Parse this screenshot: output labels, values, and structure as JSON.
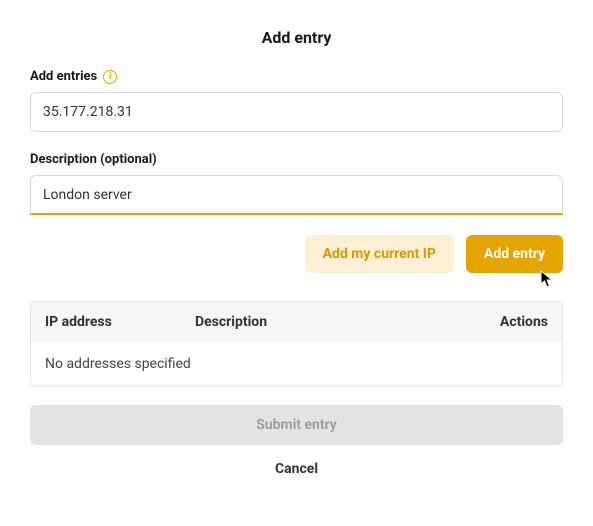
{
  "title": "Add entry",
  "fields": {
    "entries": {
      "label": "Add entries",
      "value": "35.177.218.31"
    },
    "description": {
      "label": "Description (optional)",
      "value": "London server"
    }
  },
  "buttons": {
    "add_current_ip": "Add my current IP",
    "add_entry": "Add entry",
    "submit": "Submit entry",
    "cancel": "Cancel"
  },
  "table": {
    "headers": {
      "ip": "IP address",
      "description": "Description",
      "actions": "Actions"
    },
    "empty_message": "No addresses specified"
  },
  "colors": {
    "accent": "#e5a500",
    "accent_light": "#fdf0d4"
  }
}
